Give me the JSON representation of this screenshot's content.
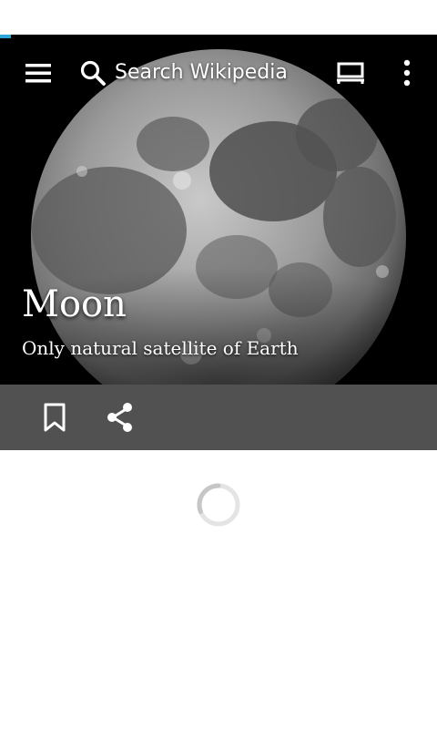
{
  "search": {
    "label": "Search Wikipedia"
  },
  "article": {
    "title": "Moon",
    "description": "Only natural satellite of Earth"
  },
  "icons": {
    "menu": "menu-icon",
    "search": "search-icon",
    "reading_list": "reading-list-icon",
    "overflow": "more-vert-icon",
    "bookmark": "bookmark-icon",
    "share": "share-icon"
  },
  "colors": {
    "action_bar": "#515151",
    "hero_background": "#000000",
    "accent": "#2aa7d6"
  }
}
